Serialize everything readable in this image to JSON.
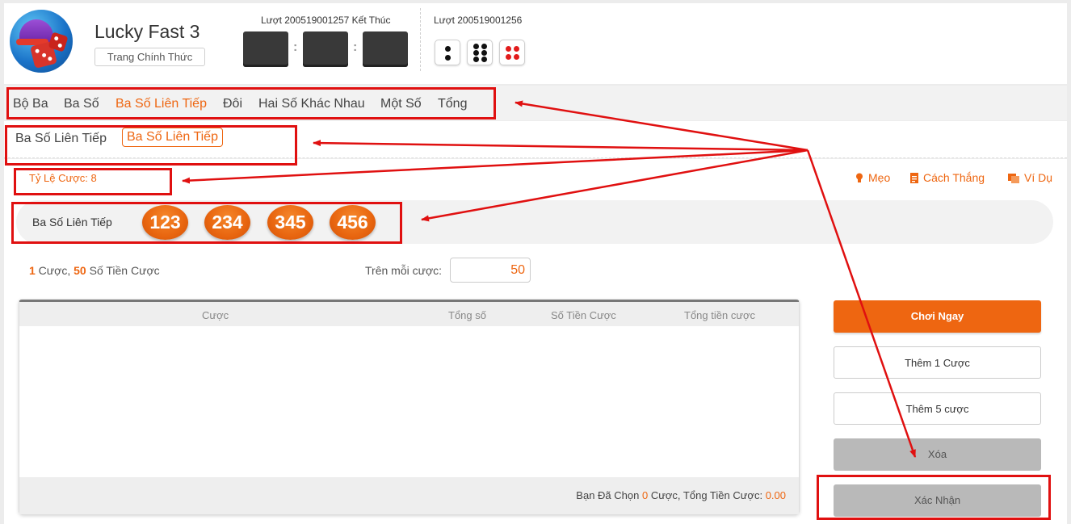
{
  "app": {
    "title": "Lucky Fast 3",
    "home_button": "Trang Chính Thức"
  },
  "round": {
    "current_label": "Lượt 200519001257 Kết Thúc",
    "previous_label": "Lượt 200519001256",
    "previous_dice": [
      2,
      6,
      4
    ]
  },
  "tabs": [
    "Bộ Ba",
    "Ba Số",
    "Ba Số Liên Tiếp",
    "Đôi",
    "Hai Số Khác Nhau",
    "Một Số",
    "Tổng"
  ],
  "active_tab": "Ba Số Liên Tiếp",
  "subtabs": [
    "Ba Số Liên Tiếp",
    "Ba Số Liên Tiếp"
  ],
  "odds_label": "Tỷ Lệ Cược: 8",
  "tools": {
    "tip": "Mẹo",
    "how_to_win": "Cách Thắng",
    "example": "Ví Dụ"
  },
  "numbers_row": {
    "label": "Ba Số Liên Tiếp",
    "numbers": [
      "123",
      "234",
      "345",
      "456"
    ]
  },
  "summary": {
    "count": "1",
    "count_suffix": " Cược, ",
    "amount": "50",
    "amount_suffix": " Số Tiền Cược"
  },
  "per_bet": {
    "label": "Trên mỗi cược:",
    "value": "50"
  },
  "table": {
    "headers": [
      "Cược",
      "Tổng số",
      "Số Tiền Cược",
      "Tổng tiền cược"
    ],
    "footer_prefix": "Bạn Đã Chọn ",
    "footer_count": "0",
    "footer_middle": " Cược, Tổng Tiền Cược: ",
    "footer_total": "0.00"
  },
  "buttons": {
    "play_now": "Chơi Ngay",
    "add_one": "Thêm 1 Cược",
    "add_five": "Thêm 5 cược",
    "delete": "Xóa",
    "confirm": "Xác Nhận"
  },
  "colors": {
    "accent": "#ee6611",
    "annotation": "#e01010"
  }
}
